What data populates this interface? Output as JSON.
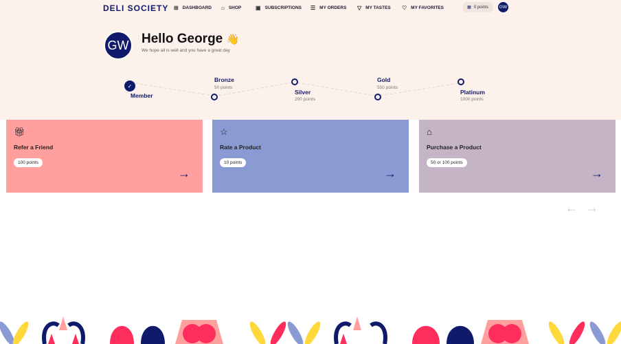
{
  "nav": {
    "logo": "DELI SOCIETY",
    "items": [
      {
        "label": "DASHBOARD",
        "icon": "grid-icon"
      },
      {
        "label": "SHOP",
        "icon": "basket-icon"
      },
      {
        "label": "SUBSCRIPTIONS",
        "icon": "box-icon"
      },
      {
        "label": "MY ORDERS",
        "icon": "list-icon"
      },
      {
        "label": "MY TASTES",
        "icon": "glass-icon"
      },
      {
        "label": "MY FAVORITES",
        "icon": "heart-icon"
      }
    ],
    "points": "0 points",
    "avatar": "GW"
  },
  "header": {
    "avatar": "GW",
    "greeting": "Hello George",
    "wave": "👋",
    "subtitle": "We hope all is well and you have a great day"
  },
  "tiers": [
    {
      "name": "Member",
      "points": ""
    },
    {
      "name": "Bronze",
      "points": "50 points"
    },
    {
      "name": "Silver",
      "points": "200 points"
    },
    {
      "name": "Gold",
      "points": "550 points"
    },
    {
      "name": "Platinum",
      "points": "1000 points"
    }
  ],
  "cards": [
    {
      "title": "Refer a Friend",
      "badge": "100 points",
      "color": "#ffa09e"
    },
    {
      "title": "Rate a Product",
      "badge": "10 points",
      "color": "#8a9bd3"
    },
    {
      "title": "Purchase a Product",
      "badge": "50 or 100 points",
      "color": "#c4b4c6"
    }
  ]
}
